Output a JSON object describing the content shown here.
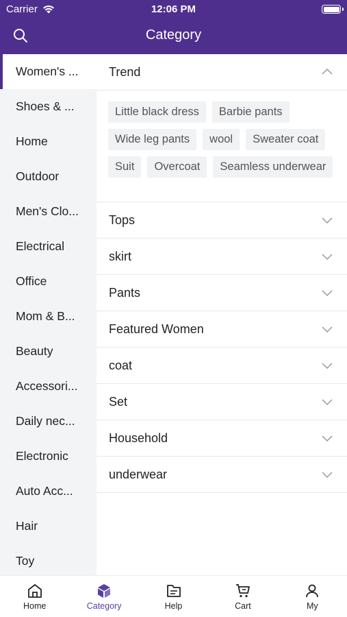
{
  "status": {
    "carrier": "Carrier",
    "time": "12:06 PM"
  },
  "header": {
    "title": "Category"
  },
  "sidebar": {
    "items": [
      {
        "label": "Women's ..."
      },
      {
        "label": "Shoes & ..."
      },
      {
        "label": "Home"
      },
      {
        "label": "Outdoor"
      },
      {
        "label": "Men's Clo..."
      },
      {
        "label": "Electrical"
      },
      {
        "label": "Office"
      },
      {
        "label": "Mom & B..."
      },
      {
        "label": "Beauty"
      },
      {
        "label": "Accessori..."
      },
      {
        "label": "Daily nec..."
      },
      {
        "label": "Electronic"
      },
      {
        "label": "Auto Acc..."
      },
      {
        "label": "Hair"
      },
      {
        "label": "Toy"
      }
    ]
  },
  "content": {
    "trend": {
      "title": "Trend",
      "tags": [
        "Little black dress",
        "Barbie pants",
        "Wide leg pants",
        "wool",
        "Sweater coat",
        "Suit",
        "Overcoat",
        "Seamless underwear"
      ]
    },
    "sections": [
      {
        "title": "Tops"
      },
      {
        "title": "skirt"
      },
      {
        "title": "Pants"
      },
      {
        "title": "Featured Women"
      },
      {
        "title": "coat"
      },
      {
        "title": "Set"
      },
      {
        "title": "Household"
      },
      {
        "title": "underwear"
      }
    ]
  },
  "tabbar": {
    "home": "Home",
    "category": "Category",
    "help": "Help",
    "cart": "Cart",
    "my": "My"
  },
  "colors": {
    "brand": "#4f2f8e",
    "active_tab": "#5a3fa6",
    "sidebar_bg": "#f3f4f6",
    "tag_bg": "#f1f2f4"
  }
}
